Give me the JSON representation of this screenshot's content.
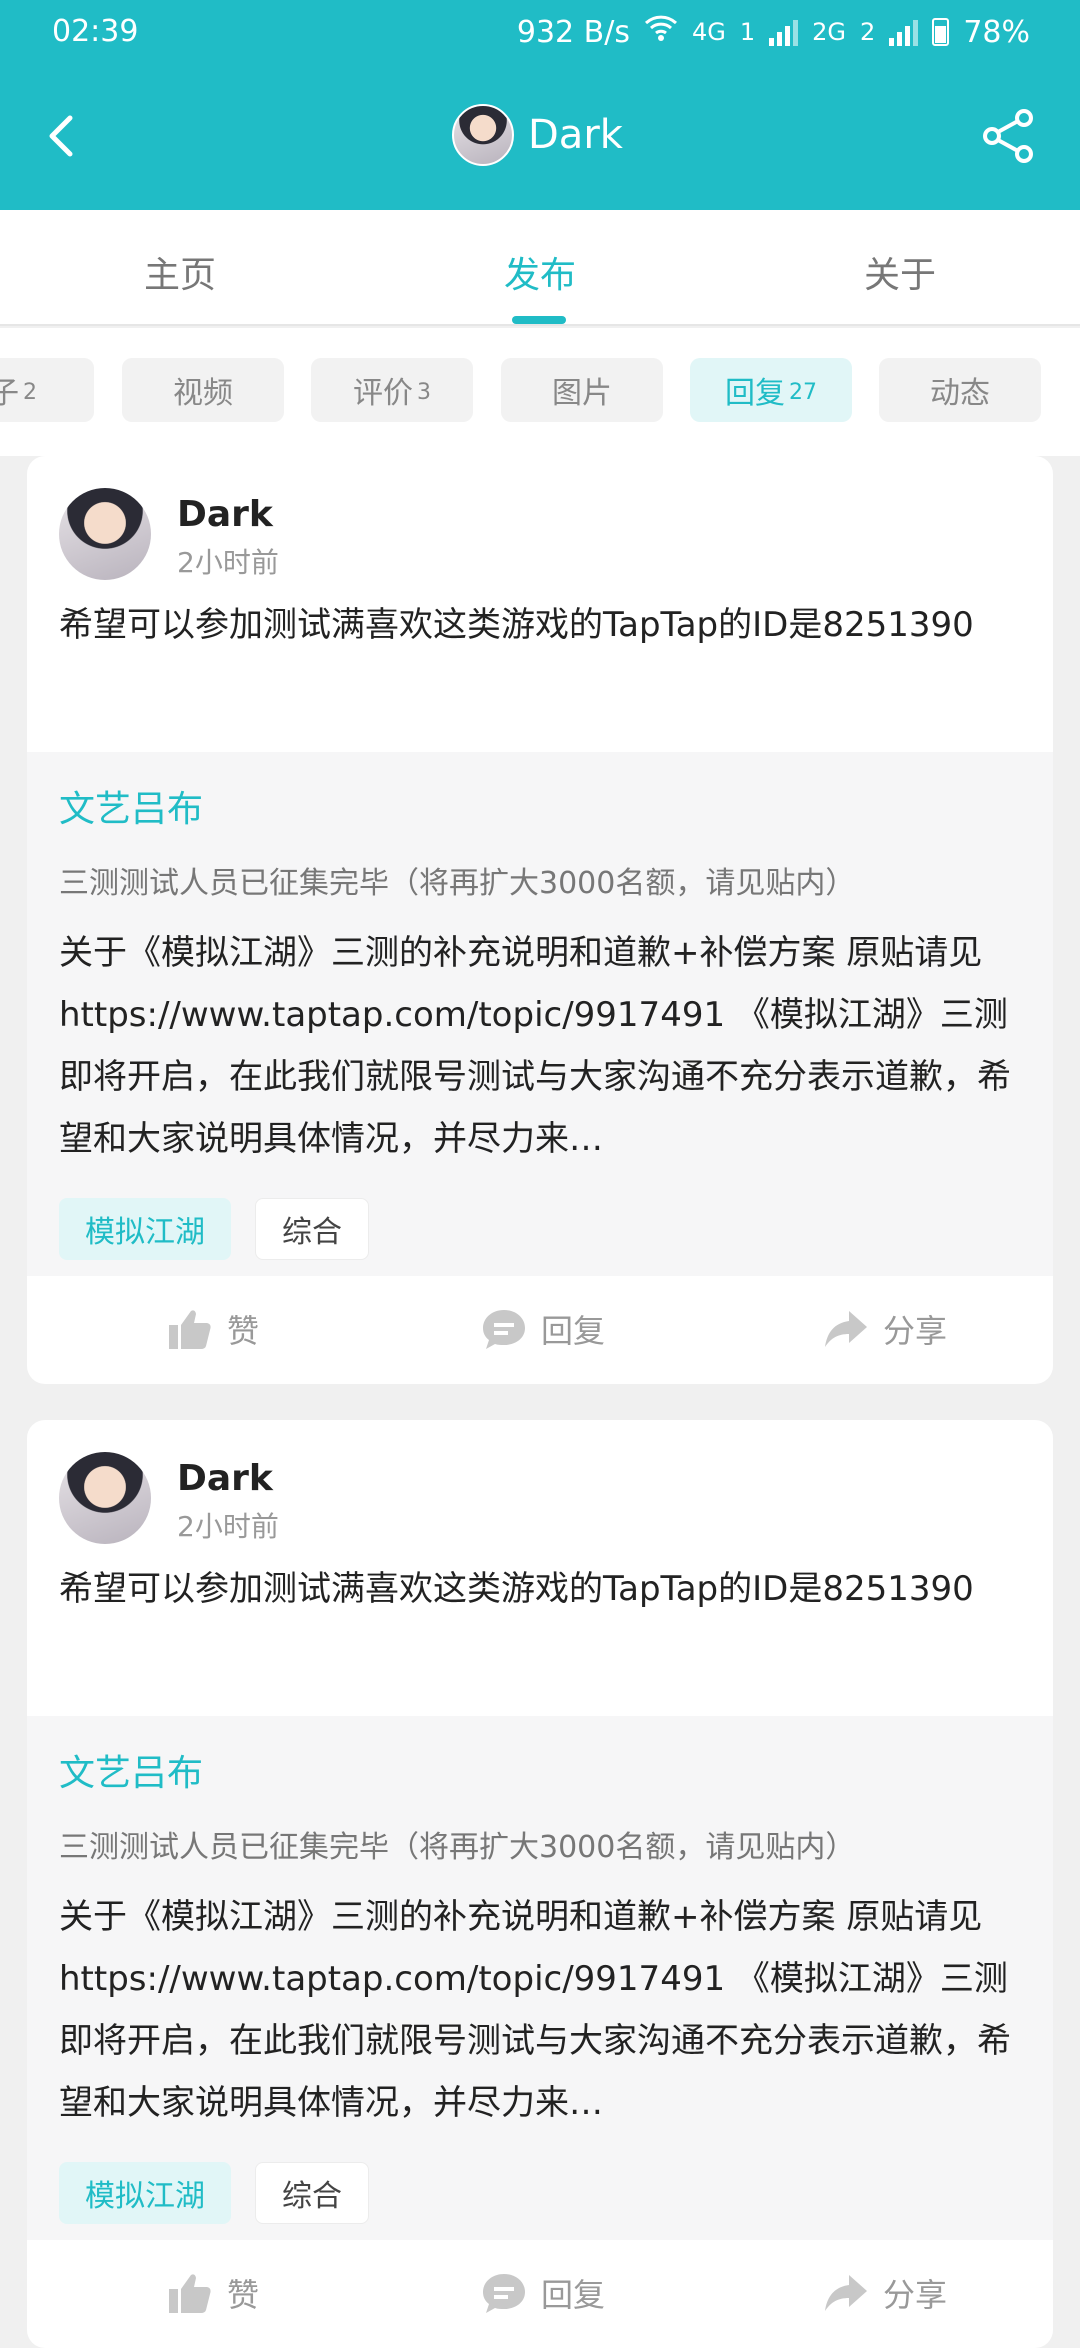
{
  "status_bar": {
    "time": "02:39",
    "net_speed": "932 B/s",
    "net1": "4G",
    "sim1": "1",
    "net2": "2G",
    "sim2": "2",
    "battery": "78%"
  },
  "app_bar": {
    "title": "Dark"
  },
  "tabs": [
    {
      "label": "主页"
    },
    {
      "label": "发布"
    },
    {
      "label": "关于"
    }
  ],
  "chips": [
    {
      "label": "子",
      "count": "2"
    },
    {
      "label": "视频",
      "count": ""
    },
    {
      "label": "评价",
      "count": "3"
    },
    {
      "label": "图片",
      "count": ""
    },
    {
      "label": "回复",
      "count": "27"
    },
    {
      "label": "动态",
      "count": ""
    }
  ],
  "posts": [
    {
      "author": "Dark",
      "time": "2小时前",
      "body": "希望可以参加测试满喜欢这类游戏的TapTap的ID是8251390",
      "quote": {
        "title": "文艺吕布",
        "subtitle": "三测测试人员已征集完毕（将再扩大3000名额，请见贴内）",
        "body": "关于《模拟江湖》三测的补充说明和道歉+补偿方案 原贴请见 https://www.taptap.com/topic/9917491 《模拟江湖》三测即将开启，在此我们就限号测试与大家沟通不充分表示道歉，希望和大家说明具体情况，并尽力来…",
        "game_tag": "模拟江湖",
        "category_tag": "综合"
      },
      "actions": {
        "like": "赞",
        "reply": "回复",
        "share": "分享"
      }
    },
    {
      "author": "Dark",
      "time": "2小时前",
      "body": "希望可以参加测试满喜欢这类游戏的TapTap的ID是8251390",
      "quote": {
        "title": "文艺吕布",
        "subtitle": "三测测试人员已征集完毕（将再扩大3000名额，请见贴内）",
        "body": "关于《模拟江湖》三测的补充说明和道歉+补偿方案 原贴请见 https://www.taptap.com/topic/9917491 《模拟江湖》三测即将开启，在此我们就限号测试与大家沟通不充分表示道歉，希望和大家说明具体情况，并尽力来…",
        "game_tag": "模拟江湖",
        "category_tag": "综合"
      },
      "actions": {
        "like": "赞",
        "reply": "回复",
        "share": "分享"
      }
    }
  ]
}
